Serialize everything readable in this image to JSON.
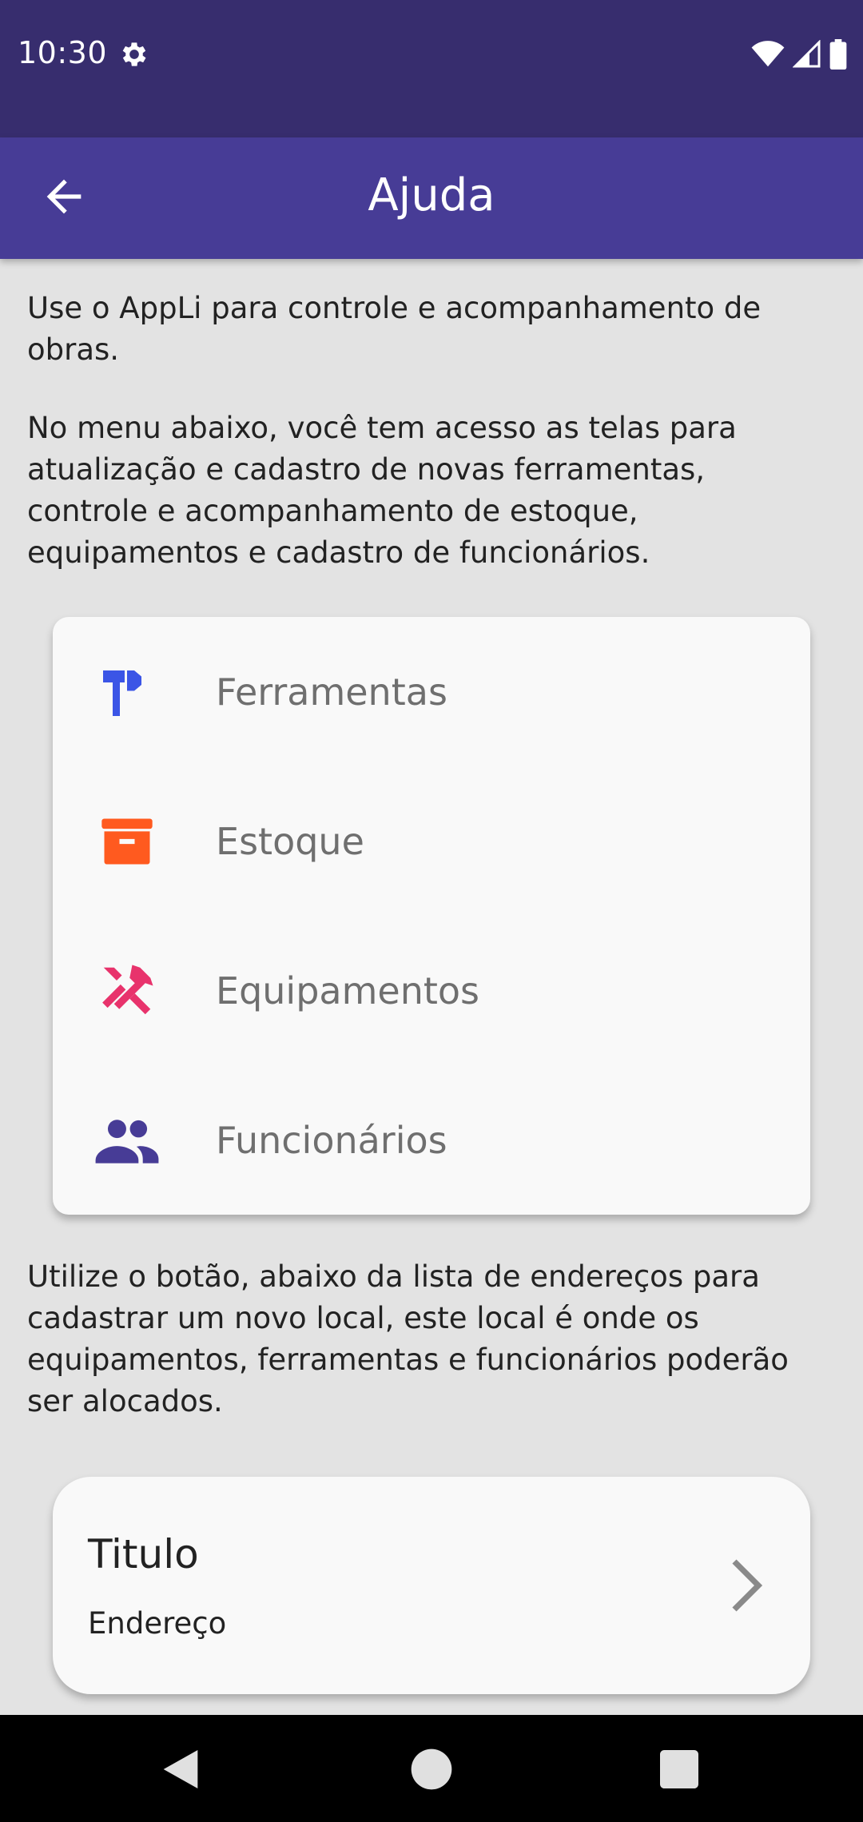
{
  "status_bar": {
    "time": "10:30",
    "icons": [
      "gear-icon",
      "wifi-icon",
      "signal-icon",
      "battery-icon"
    ]
  },
  "app_bar": {
    "title": "Ajuda",
    "back_icon": "arrow-back-icon"
  },
  "content": {
    "intro": "Use o AppLi para controle e acompanhamento de obras.",
    "menu_description": "No menu abaixo, você tem acesso as telas para atualização e cadastro de novas ferramentas, controle e acompanhamento de estoque, equipamentos e cadastro de funcionários.",
    "menu_items": [
      {
        "label": "Ferramentas",
        "icon": "hammer-icon",
        "color": "#3b55e6"
      },
      {
        "label": "Estoque",
        "icon": "archive-box-icon",
        "color": "#ff5a1f"
      },
      {
        "label": "Equipamentos",
        "icon": "tools-icon",
        "color": "#e8336c"
      },
      {
        "label": "Funcionários",
        "icon": "people-icon",
        "color": "#473c96"
      }
    ],
    "address_description": "Utilize o botão, abaixo da lista de endereços para cadastrar um novo local, este local é onde os equipamentos, ferramentas e funcionários poderão ser alocados.",
    "address_card": {
      "title": "Titulo",
      "subtitle": "Endereço"
    }
  },
  "colors": {
    "status_bar": "#372d6e",
    "app_bar": "#473c96",
    "background": "#e3e3e3"
  }
}
